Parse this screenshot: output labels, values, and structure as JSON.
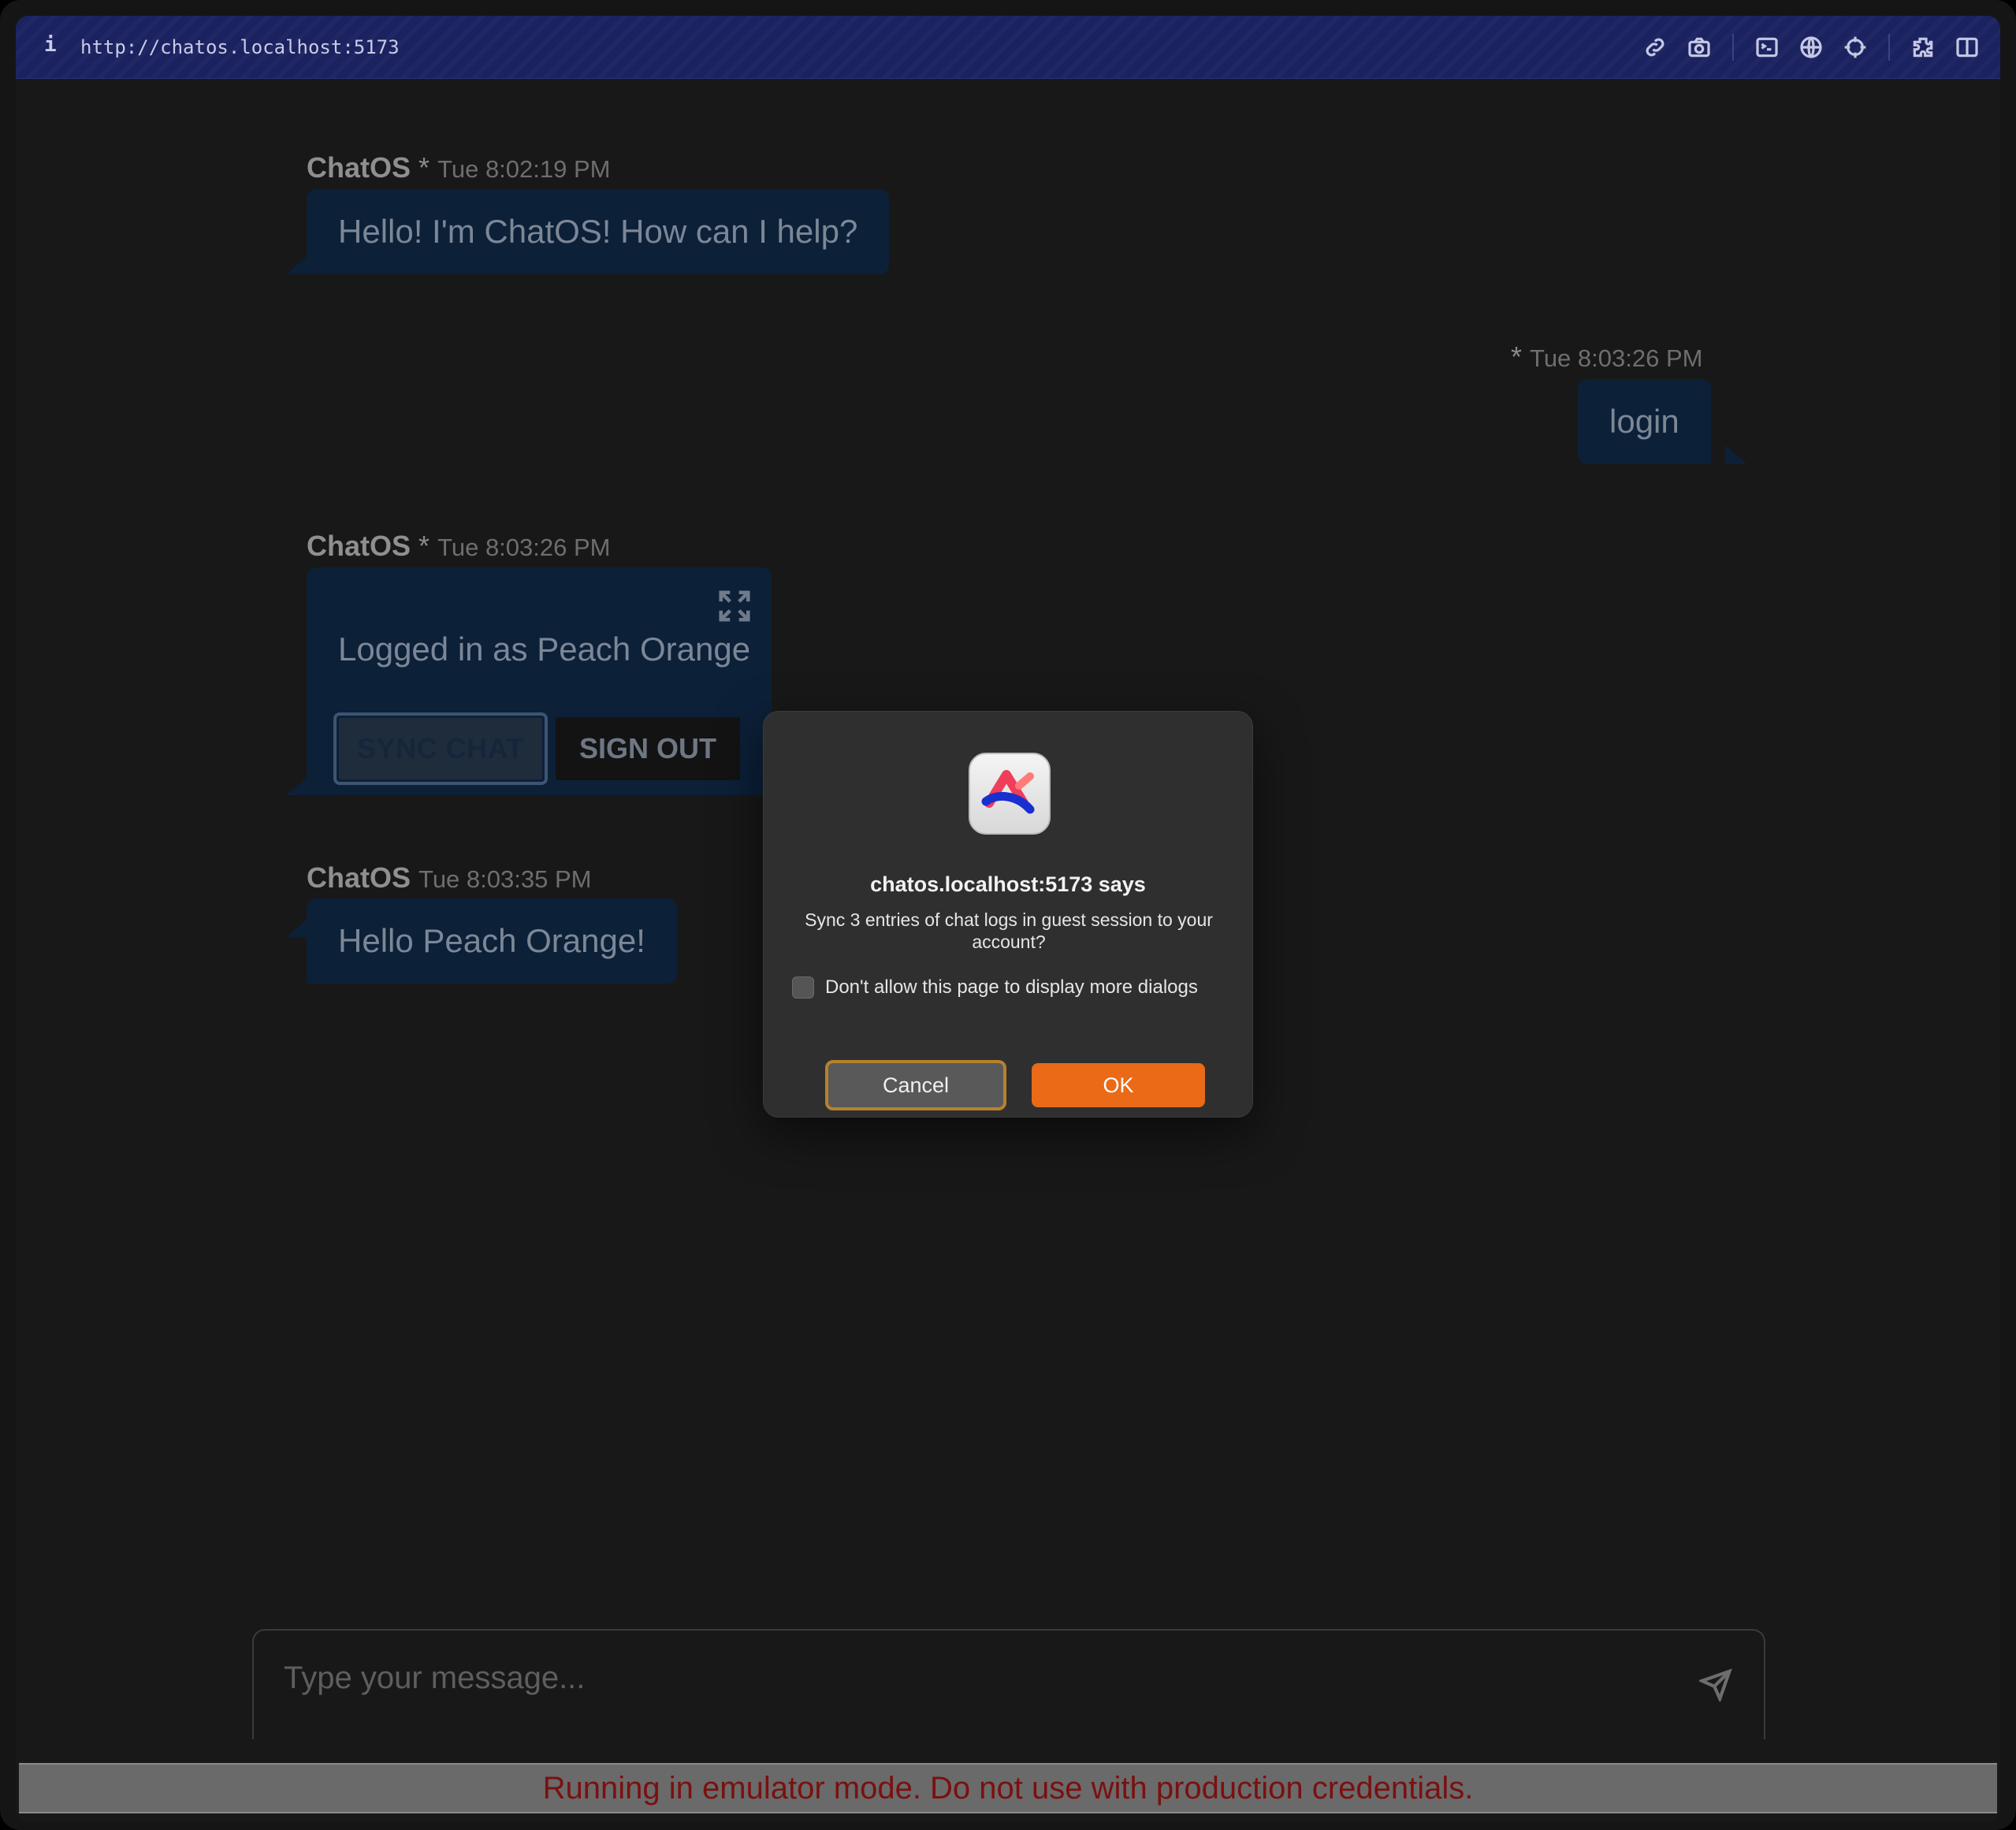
{
  "browser": {
    "info_glyph": "i",
    "url": "http://chatos.localhost:5173",
    "toolbar_icons": [
      "link-icon",
      "camera-icon",
      "terminal-icon",
      "globe-icon",
      "crosshair-icon",
      "extensions-icon",
      "split-view-icon"
    ]
  },
  "chat": {
    "messages": [
      {
        "sender": "ChatOS",
        "marker": "*",
        "time": "Tue 8:02:19 PM",
        "text": "Hello! I'm ChatOS! How can I help?"
      },
      {
        "sender": "",
        "marker": "*",
        "time": "Tue 8:03:26 PM",
        "text": "login"
      },
      {
        "sender": "ChatOS",
        "marker": "*",
        "time": "Tue 8:03:26 PM",
        "text": "Logged in as Peach Orange",
        "buttons": {
          "sync": "SYNC CHAT",
          "signout": "SIGN OUT"
        }
      },
      {
        "sender": "ChatOS",
        "marker": "",
        "time": "Tue 8:03:35 PM",
        "text": "Hello Peach Orange!"
      }
    ]
  },
  "composer": {
    "placeholder": "Type your message..."
  },
  "banner": {
    "text": "Running in emulator mode. Do not use with production credentials."
  },
  "dialog": {
    "title": "chatos.localhost:5173 says",
    "message": "Sync 3 entries of chat logs in guest session to your account?",
    "checkbox_label": "Don't allow this page to display more dialogs",
    "checkbox_checked": false,
    "cancel": "Cancel",
    "ok": "OK",
    "ok_color": "#ea6a17"
  }
}
